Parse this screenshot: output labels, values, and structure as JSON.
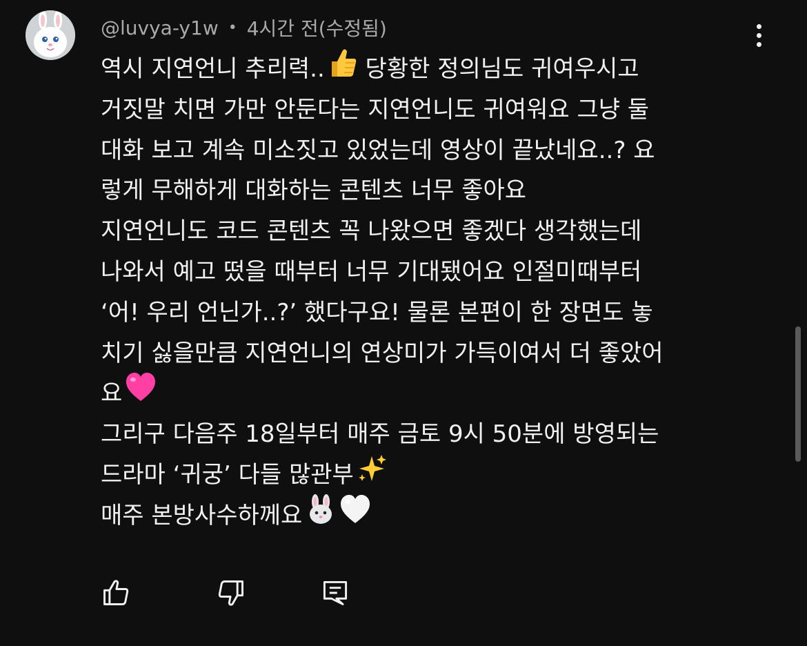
{
  "comment": {
    "author": "@luvya-y1w",
    "separator": "•",
    "timestamp": "4시간 전(수정됨)",
    "lines": [
      {
        "text": "역시 지연언니 추리력..",
        "emoji": "thumbs-up",
        "tail": " 당황한 정의님도 귀여우시고"
      },
      {
        "text": "거짓말 치면 가만 안둔다는 지연언니도 귀여워요 그냥 둘"
      },
      {
        "text": "대화 보고 계속 미소짓고 있었는데 영상이 끝났네요..? 요"
      },
      {
        "text": "렇게 무해하게 대화하는 콘텐츠 너무 좋아요"
      },
      {
        "text": "지연언니도 코드 콘텐츠 꼭 나왔으면 좋겠다 생각했는데"
      },
      {
        "text": "나와서 예고 떴을 때부터 너무 기대됐어요 인절미때부터"
      },
      {
        "text": "‘어! 우리 언닌가..?’ 했다구요! 물론 본편이 한 장면도 놓"
      },
      {
        "text": "치기 싫을만큼 지연언니의 연상미가 가득이여서 더 좋았어"
      },
      {
        "text": "요",
        "emoji": "pink-heart"
      },
      {
        "text": "그리구 다음주 18일부터 매주 금토 9시 50분에 방영되는"
      },
      {
        "text": "드라마 ‘귀궁’ 다들 많관부",
        "emoji": "sparkles"
      },
      {
        "text": "매주 본방사수하께요",
        "emoji": "rabbit-face",
        "emoji2": "white-heart"
      }
    ]
  },
  "actions": {
    "like_icon": "thumbs-up-outline-icon",
    "dislike_icon": "thumbs-down-outline-icon",
    "reply_icon": "comment-reply-icon"
  },
  "colors": {
    "background": "#0f0f0f",
    "text": "#f1f1f1",
    "meta": "#aaaaaa",
    "heart": "#ff3fa4"
  }
}
